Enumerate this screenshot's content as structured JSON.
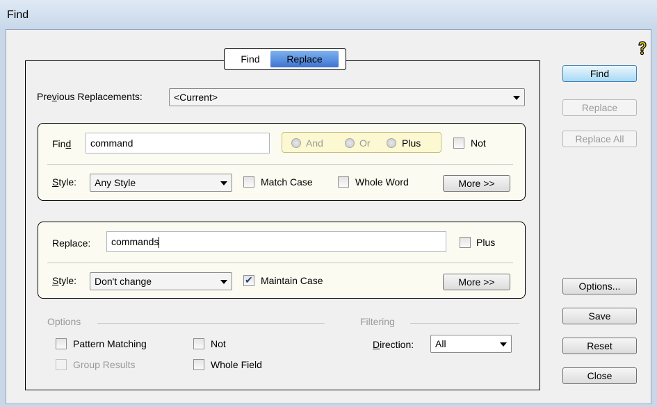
{
  "window": {
    "title": "Find"
  },
  "tabs": {
    "find": "Find",
    "replace": "Replace"
  },
  "previous": {
    "label_pre": "Pre",
    "label_acc": "v",
    "label_post": "ious Replacements:",
    "value": "<Current>"
  },
  "find_group": {
    "label_pre": "Fin",
    "label_acc": "d",
    "value": "command",
    "logic": {
      "and": "And",
      "or": "Or",
      "plus": "Plus"
    },
    "not_label": "Not",
    "style_acc": "S",
    "style_rest": "tyle:",
    "style_value": "Any Style",
    "match_case": "Match Case",
    "whole_word": "Whole Word",
    "more": "More >>"
  },
  "replace_group": {
    "label": "Replace:",
    "value": "commands",
    "plus_label": "Plus",
    "style_acc": "S",
    "style_rest": "tyle:",
    "style_value": "Don't change",
    "maintain_case": "Maintain Case",
    "maintain_case_checked": true,
    "more": "More >>"
  },
  "options": {
    "header": "Options",
    "pattern_matching": "Pattern Matching",
    "group_results": "Group Results",
    "not": "Not",
    "whole_field": "Whole Field"
  },
  "filtering": {
    "header": "Filtering",
    "direction_acc": "D",
    "direction_rest": "irection:",
    "direction_value": "All"
  },
  "buttons": {
    "find": "Find",
    "replace": "Replace",
    "replace_all": "Replace All",
    "options": "Options...",
    "save": "Save",
    "reset": "Reset",
    "close": "Close"
  },
  "icons": {
    "help": "help-icon"
  }
}
